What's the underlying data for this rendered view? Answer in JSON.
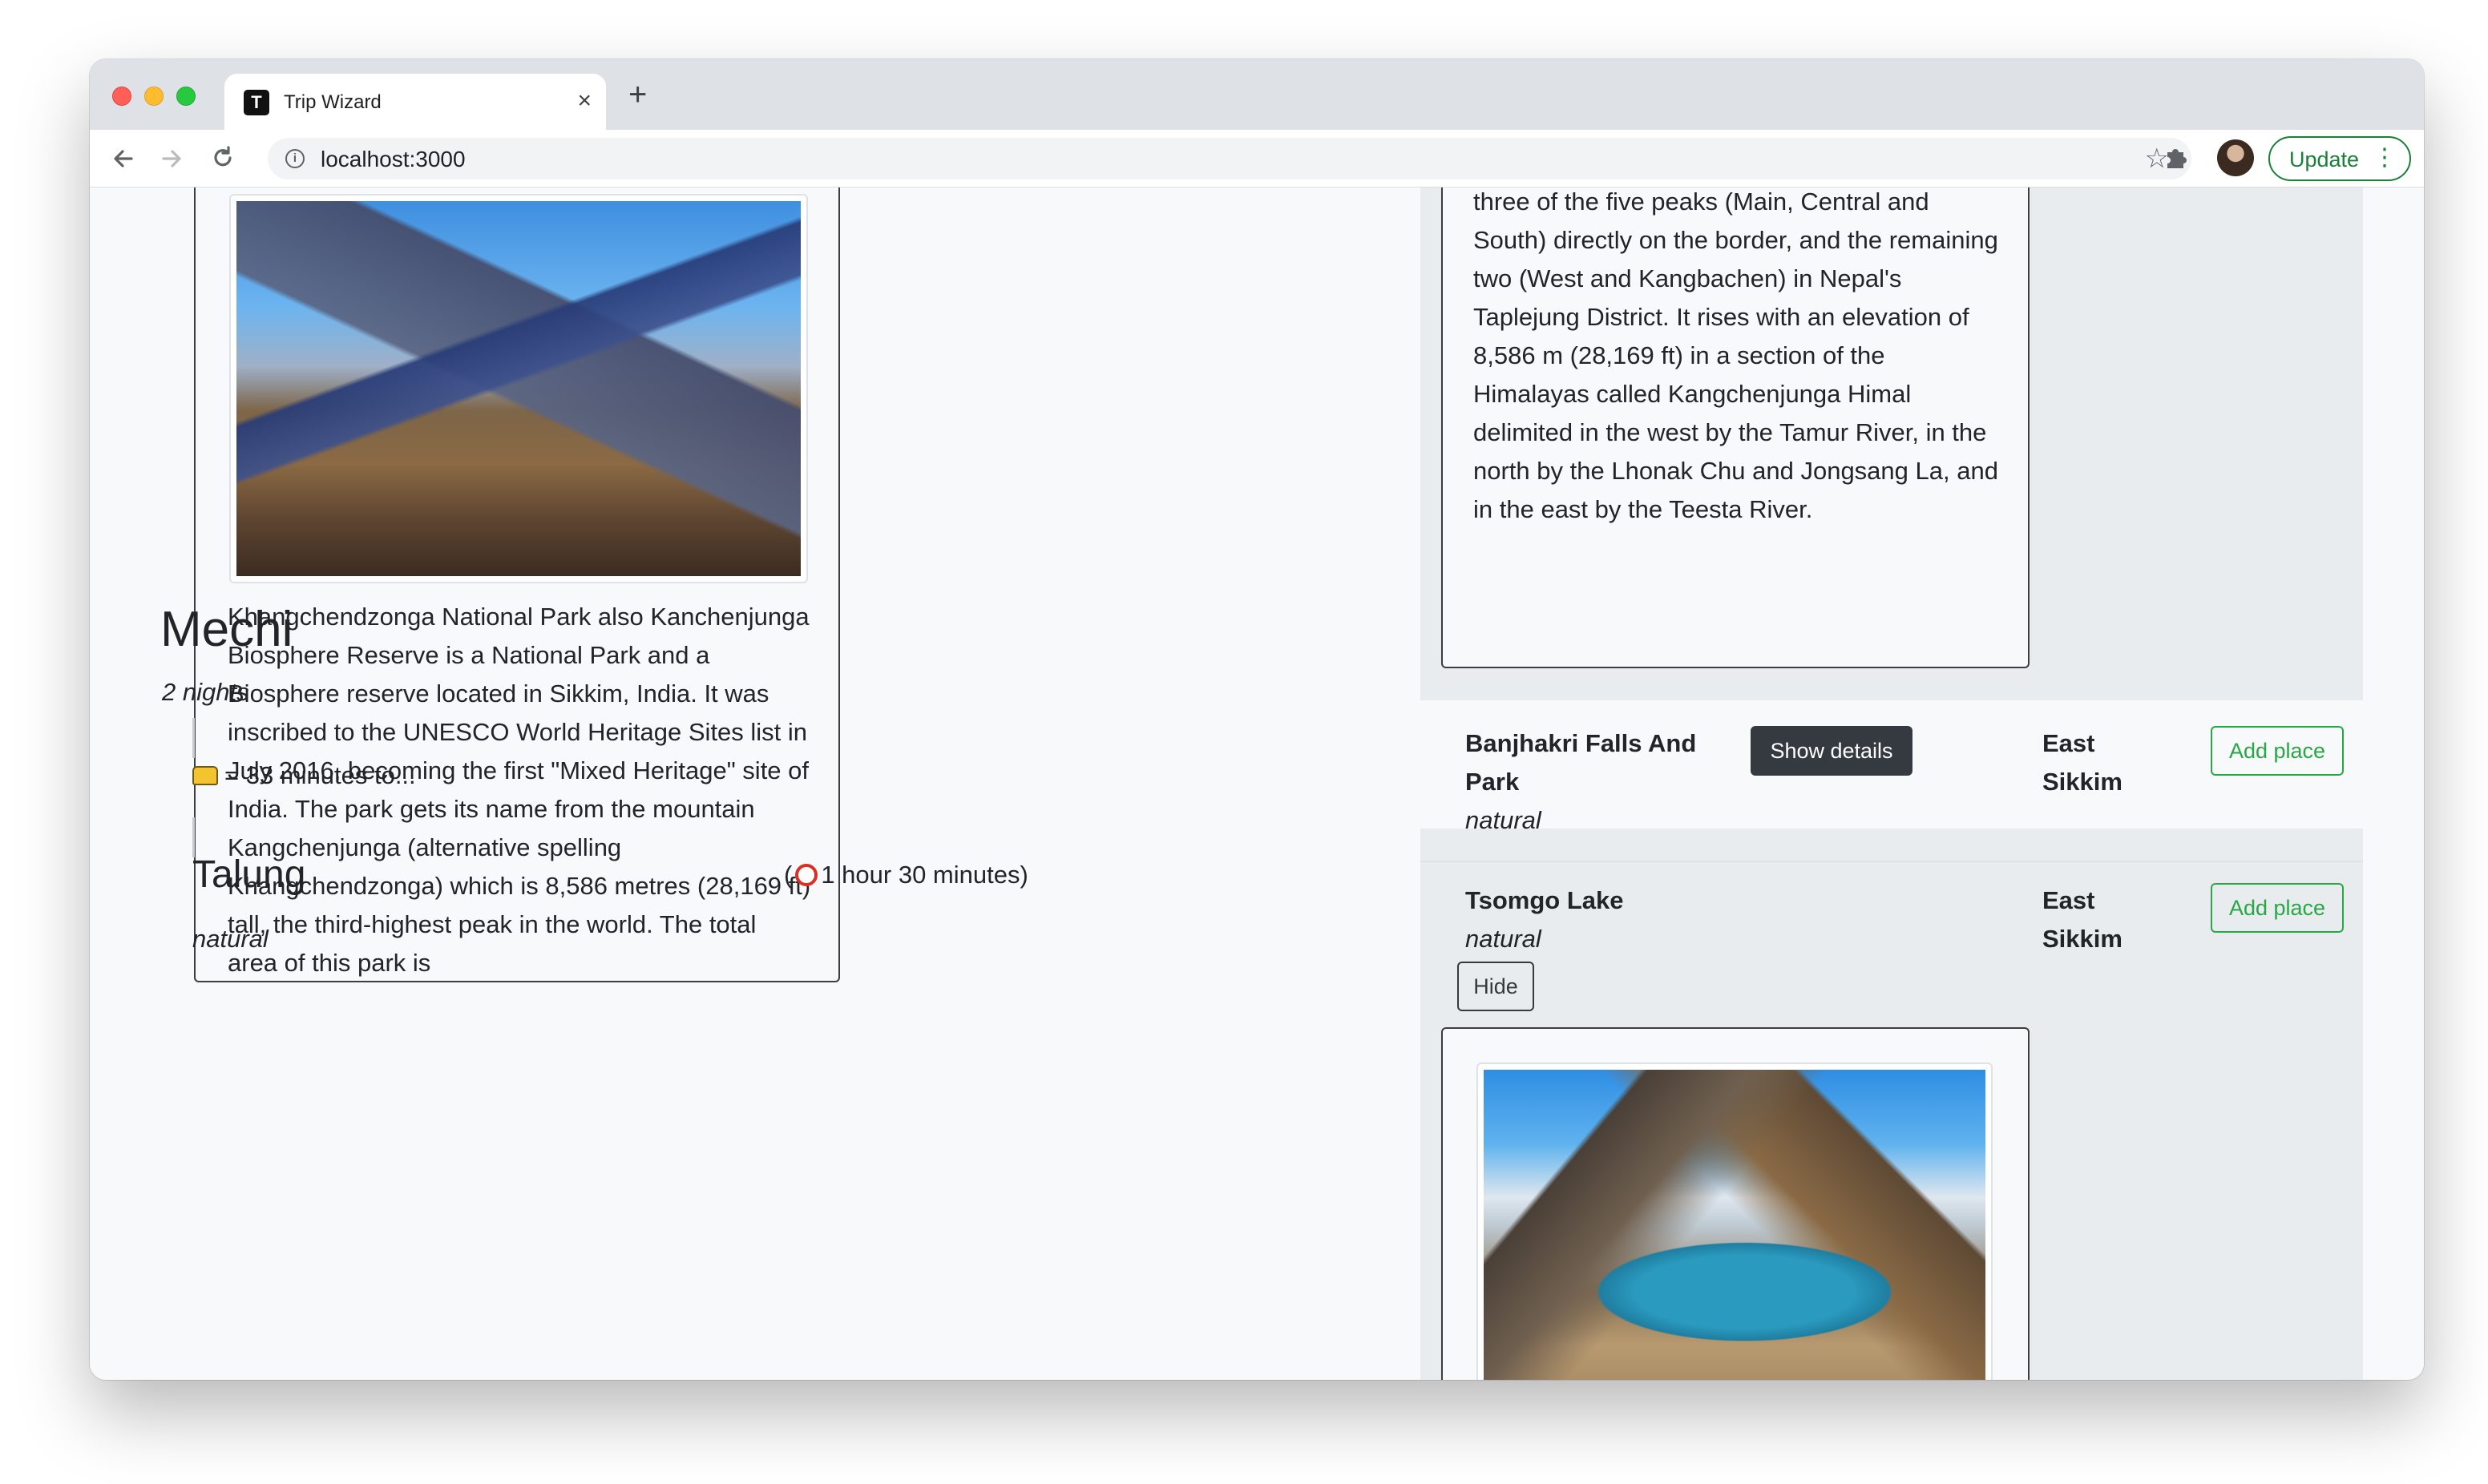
{
  "browser": {
    "tab_title": "Trip Wizard",
    "tab_favicon": "T",
    "url": "localhost:3000",
    "update_label": "Update",
    "icons": {
      "back": "arrow-left",
      "forward": "arrow-right",
      "reload": "reload",
      "info": "i",
      "star": "☆",
      "extensions": "puzzle",
      "menu": "⋮",
      "close": "×",
      "new_tab": "+"
    }
  },
  "left": {
    "park_description": "Khangchendzonga National Park also Kanchenjunga Biosphere Reserve is a National Park and a Biosphere reserve located in Sikkim, India. It was inscribed to the UNESCO World Heritage Sites list in July 2016, becoming the first \"Mixed Heritage\" site of India. The park gets its name from the mountain Kangchenjunga (alternative spelling Khangchendzonga) which is 8,586 metres (28,169 ft) tall, the third-highest peak in the world. The total area of this park is",
    "stop_name": "Mechi",
    "stop_nights": "2 nights",
    "travel_text": "= 33 minutes to...",
    "next_place": "Talung",
    "next_duration_open": "(",
    "next_duration_text": "1 hour 30 minutes)",
    "next_type": "natural"
  },
  "right": {
    "top_description": "three of the five peaks (Main, Central and South) directly on the border, and the remaining two (West and Kangbachen) in Nepal's Taplejung District. It rises with an elevation of 8,586 m (28,169 ft) in a section of the Himalayas called Kangchenjunga Himal delimited in the west by the Tamur River, in the north by the Lhonak Chu and Jongsang La, and in the east by the Teesta River.",
    "places": [
      {
        "name": "Banjhakri Falls And Park",
        "type": "natural",
        "region": "East Sikkim",
        "details_label": "Show details",
        "add_label": "Add place"
      },
      {
        "name": "Tsomgo Lake",
        "type": "natural",
        "region": "East Sikkim",
        "hide_label": "Hide",
        "add_label": "Add place"
      }
    ]
  },
  "colors": {
    "success": "#28a745",
    "dark": "#343a40",
    "panel": "#e9ecef"
  }
}
